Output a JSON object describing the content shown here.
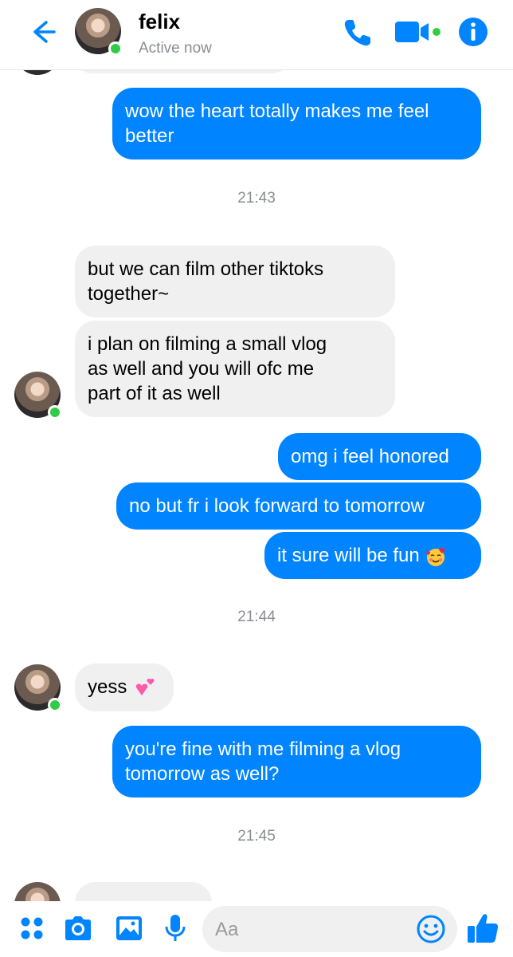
{
  "header": {
    "name": "felix",
    "status": "Active now"
  },
  "messages": [
    {
      "type": "outgoing",
      "lines": [
        "wow the heart totally makes me feel",
        "better"
      ]
    },
    {
      "type": "timestamp",
      "text": "21:43"
    },
    {
      "type": "incoming",
      "lines": [
        "but we can film other tiktoks",
        "together~"
      ]
    },
    {
      "type": "incoming",
      "lines": [
        "i plan on filming a small vlog",
        "as well and you will ofc me",
        "part of it as well"
      ]
    },
    {
      "type": "outgoing",
      "lines": [
        "omg i feel honored"
      ]
    },
    {
      "type": "outgoing",
      "lines": [
        "no but fr i look forward to tomorrow"
      ]
    },
    {
      "type": "outgoing",
      "lines": [
        "it sure will be fun"
      ],
      "emoji": "smiling-face-with-hearts"
    },
    {
      "type": "timestamp",
      "text": "21:44"
    },
    {
      "type": "incoming",
      "lines": [
        "yess"
      ],
      "emoji": "two-hearts"
    },
    {
      "type": "outgoing",
      "lines": [
        "you're fine with me filming a vlog",
        "tomorrow as well?"
      ]
    },
    {
      "type": "timestamp",
      "text": "21:45"
    }
  ],
  "composer": {
    "placeholder": "Aa"
  },
  "icons": {
    "back": "back-arrow-icon",
    "call": "phone-icon",
    "video": "video-camera-icon",
    "info": "info-icon",
    "apps": "apps-grid-icon",
    "camera": "camera-icon",
    "gallery": "image-icon",
    "mic": "microphone-icon",
    "emoji": "emoji-icon",
    "like": "thumbs-up-icon"
  },
  "colors": {
    "accent": "#0084ff",
    "incoming_bubble": "#f0f0f0",
    "active": "#31cc46"
  }
}
